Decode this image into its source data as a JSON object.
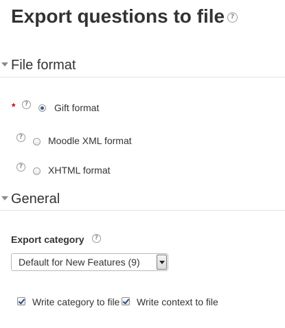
{
  "page": {
    "title": "Export questions to file"
  },
  "file_format_section": {
    "title": "File format",
    "options": [
      {
        "label": "Gift format",
        "selected": true
      },
      {
        "label": "Moodle XML format",
        "selected": false
      },
      {
        "label": "XHTML format",
        "selected": false
      }
    ],
    "required_marker": "*"
  },
  "general_section": {
    "title": "General",
    "export_category": {
      "label": "Export category",
      "selected_value": "Default for New Features (9)"
    },
    "checkboxes": [
      {
        "label": "Write category to file",
        "checked": true
      },
      {
        "label": "Write context to file",
        "checked": true
      }
    ]
  },
  "icons": {
    "help": "?"
  },
  "colors": {
    "required": "#cc0000",
    "text": "#333333",
    "rule": "#e3e3e3"
  }
}
